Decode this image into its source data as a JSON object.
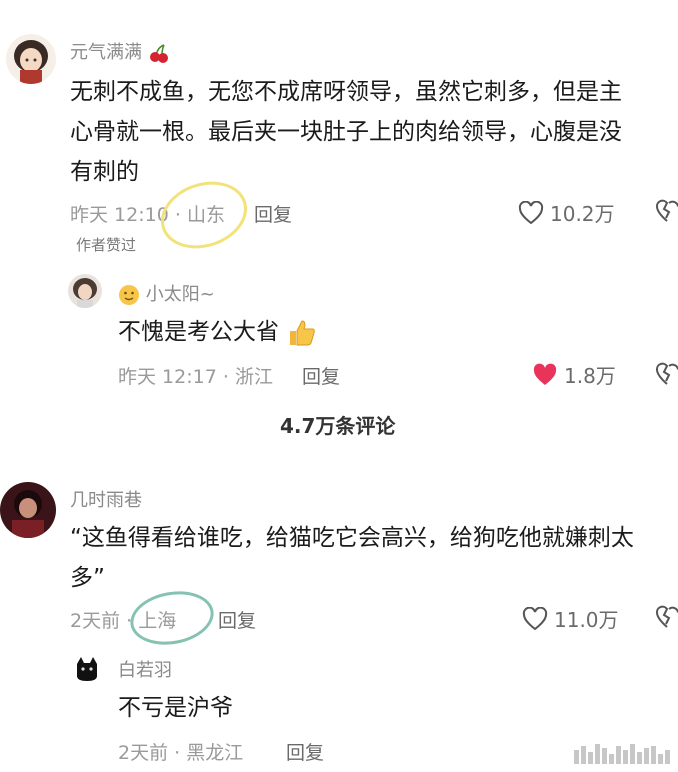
{
  "comments": [
    {
      "username": "元气满满",
      "text_lines": [
        "无刺不成鱼，无您不成席呀领导，虽然它刺多，但是主",
        "心骨就一根。最后夹一块肚子上的肉给领导，心腹是没",
        "有刺的"
      ],
      "time": "昨天 12:10",
      "location": "山东",
      "reply_label": "回复",
      "likes": "10.2万",
      "badge": "作者赞过",
      "reply": {
        "username": "小太阳~",
        "text": "不愧是考公大省",
        "time": "昨天 12:17",
        "location": "浙江",
        "reply_label": "回复",
        "likes": "1.8万",
        "liked": true,
        "like_color": "#e8345a"
      }
    },
    {
      "username": "几时雨巷",
      "text_lines": [
        "“这鱼得看给谁吃，给猫吃它会高兴，给狗吃他就嫌刺太",
        "多”"
      ],
      "time": "2天前",
      "location": "上海",
      "reply_label": "回复",
      "likes": "11.0万",
      "reply": {
        "username": "白若羽",
        "text": "不亏是沪爷",
        "time": "2天前",
        "location": "黑龙江",
        "reply_label": "回复"
      }
    }
  ],
  "more_comments": "4.7万条评论",
  "colors": {
    "circle_yellow": "#f3e27a",
    "circle_teal": "#86c2b2"
  }
}
